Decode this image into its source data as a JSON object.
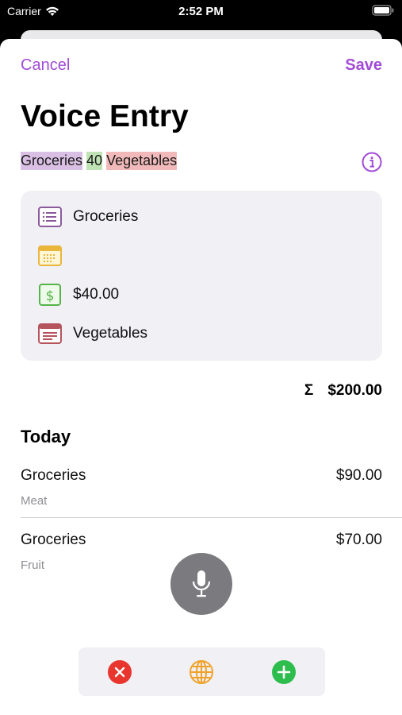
{
  "status": {
    "carrier": "Carrier",
    "time": "2:52 PM"
  },
  "nav": {
    "cancel": "Cancel",
    "save": "Save"
  },
  "title": "Voice Entry",
  "tokens": [
    {
      "text": "Groceries",
      "color": "#d9bfe3"
    },
    {
      "text": "40",
      "color": "#bfe3b5"
    },
    {
      "text": "Vegetables",
      "color": "#f1b9b9"
    }
  ],
  "summary": {
    "category": "Groceries",
    "date": "",
    "amount": "$40.00",
    "note": "Vegetables"
  },
  "total": {
    "symbol": "Σ",
    "value": "$200.00"
  },
  "section": "Today",
  "entries": [
    {
      "name": "Groceries",
      "sub": "Meat",
      "amount": "$90.00"
    },
    {
      "name": "Groceries",
      "sub": "Fruit",
      "amount": "$70.00"
    }
  ],
  "colors": {
    "accent": "#a24bd6",
    "red": "#e8362e",
    "orange": "#f0a22b",
    "green": "#2dbd4c"
  }
}
